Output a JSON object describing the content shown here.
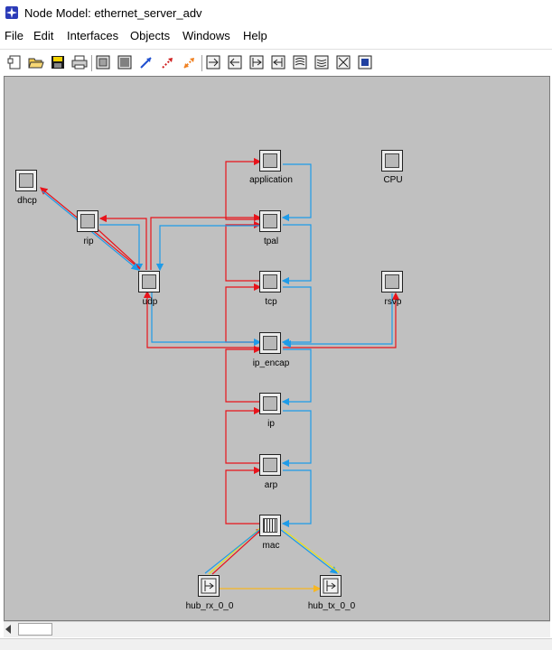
{
  "window": {
    "title": "Node Model: ethernet_server_adv"
  },
  "menu": [
    "File",
    "Edit",
    "Interfaces",
    "Objects",
    "Windows",
    "Help"
  ],
  "toolbar": {
    "buttons": [
      "new-node-icon",
      "open-folder-icon",
      "save-disk-icon",
      "print-icon",
      "processor-icon",
      "queue-icon",
      "packet-stream-icon",
      "statistic-wire-icon",
      "association-icon",
      "point-to-point-tx-icon",
      "point-to-point-rx-icon",
      "bus-tx-icon",
      "bus-rx-icon",
      "radio-tx-icon",
      "radio-rx-icon",
      "antenna-icon",
      "external-system-icon"
    ]
  },
  "colors": {
    "canvas": "#c0c0c0",
    "packet_stream": "#e8131b",
    "stat_wire": "#1e9be8",
    "bus_link": "#f7b722",
    "mac_yellow": "#e8e020"
  },
  "nodes": {
    "application": "application",
    "cpu": "CPU",
    "dhcp": "dhcp",
    "rip": "rip",
    "tpal": "tpal",
    "udp": "udp",
    "tcp": "tcp",
    "rsvp": "rsvp",
    "ip_encap": "ip_encap",
    "ip": "ip",
    "arp": "arp",
    "mac": "mac",
    "hub_rx": "hub_rx_0_0",
    "hub_tx": "hub_tx_0_0"
  }
}
